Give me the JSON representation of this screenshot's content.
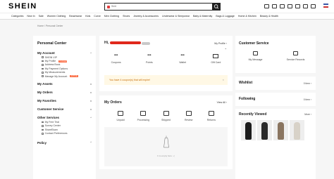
{
  "header": {
    "logo": "SHEIN",
    "search_value": "Skirt"
  },
  "nav": {
    "items": [
      "Categories",
      "New In",
      "Sale",
      "Women Clothing",
      "Beachwear",
      "Kids",
      "Curve",
      "Men Clothing",
      "Shoes",
      "Jewelry & Accessories",
      "Underwear & Sleepwear",
      "Baby & Maternity",
      "Bags & Luggage",
      "Home & Kitchen",
      "Beauty & Health"
    ]
  },
  "breadcrumb": "Home / Personal Center",
  "sidebar": {
    "title": "Personal Center",
    "my_account": "My Account",
    "items": [
      {
        "label": "SHEIN VIP",
        "badge": ""
      },
      {
        "label": "My Profile",
        "badge": "4 unread"
      },
      {
        "label": "Address Book",
        "badge": ""
      },
      {
        "label": "My Payment Options",
        "badge": ""
      },
      {
        "label": "My Measurements",
        "badge": ""
      },
      {
        "label": "Manage My Account",
        "badge": "ACTIVE"
      }
    ],
    "my_assets": "My Assets",
    "my_orders": "My Orders",
    "my_favorites": "My Favorites",
    "customer_service": "Customer Service",
    "other_services": "Other Services",
    "other_items": [
      "My Free Trial",
      "Survey Center",
      "ShareEkam",
      "Contact Preferences"
    ],
    "policy": "Policy"
  },
  "profile": {
    "greeting": "Hi,",
    "my_profile": "My Profile",
    "assets": [
      {
        "value": "•••",
        "label": "Coupons"
      },
      {
        "value": "•••",
        "label": "Points"
      },
      {
        "value": "•••",
        "label": "Wallet"
      },
      {
        "value": "",
        "label": "Gift Card"
      }
    ],
    "notice": "You have 4 coupon(s) that will expire!"
  },
  "orders": {
    "title": "My Orders",
    "view_all": "View All",
    "statuses": [
      "Unpaid",
      "Processing",
      "Shipped",
      "Review",
      "Returns"
    ],
    "empty_text": "It is empty here :-("
  },
  "customer_service": {
    "title": "Customer Service",
    "items": [
      "My Message",
      "Service Records"
    ]
  },
  "wishlist": {
    "title": "Wishlist",
    "count": "0 item"
  },
  "following": {
    "title": "Following",
    "count": "0 item"
  },
  "recently_viewed": {
    "title": "Recently Viewed",
    "more": "More"
  },
  "colors": {
    "accent": "#fa6338",
    "notice_bg": "#fff8e5"
  }
}
